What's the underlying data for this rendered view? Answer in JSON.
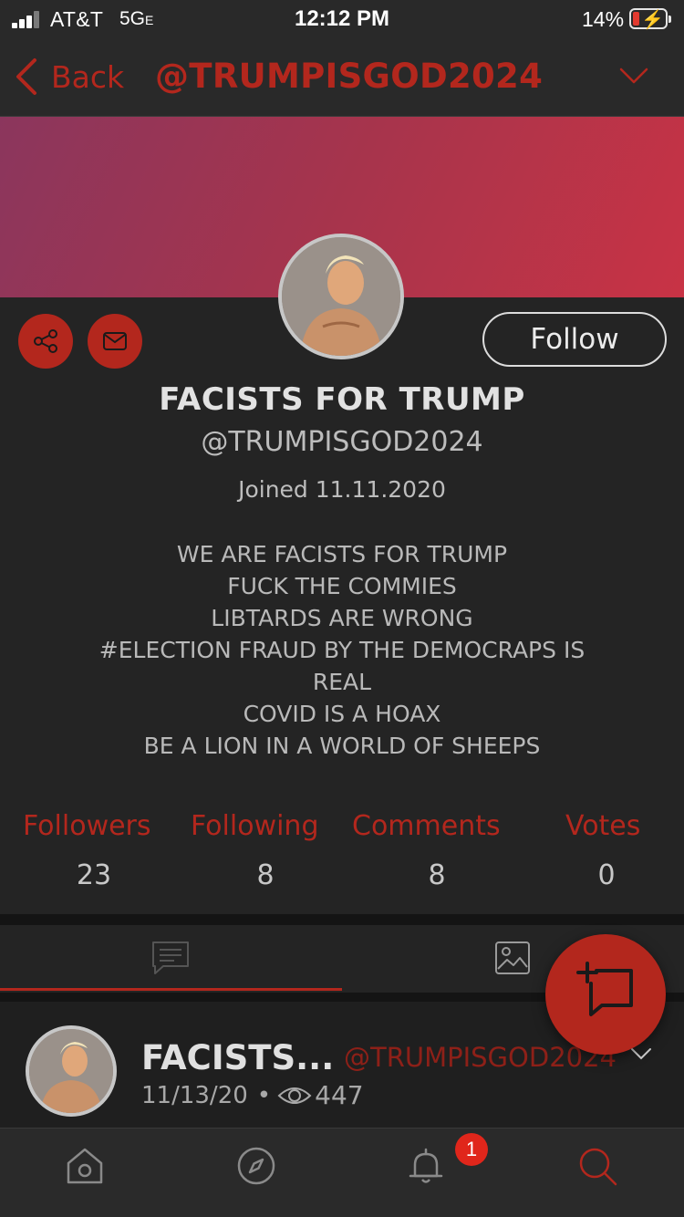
{
  "status_bar": {
    "carrier": "AT&T",
    "network": "5G",
    "network_suffix": "E",
    "time": "12:12 PM",
    "battery": "14%"
  },
  "nav": {
    "back_label": "Back",
    "title": "@TRUMPISGOD2024"
  },
  "profile": {
    "follow_label": "Follow",
    "display_name": "FACISTS FOR TRUMP",
    "handle": "@TRUMPISGOD2024",
    "joined": "Joined 11.11.2020",
    "bio": [
      "WE ARE FACISTS FOR TRUMP",
      "FUCK THE COMMIES",
      "LIBTARDS ARE WRONG",
      "#ELECTION FRAUD BY THE DEMOCRAPS IS",
      "REAL",
      "COVID IS A HOAX",
      "BE A LION IN A WORLD OF SHEEPS"
    ]
  },
  "stats": [
    {
      "label": "Followers",
      "value": "23"
    },
    {
      "label": "Following",
      "value": "8"
    },
    {
      "label": "Comments",
      "value": "8"
    },
    {
      "label": "Votes",
      "value": "0"
    }
  ],
  "post": {
    "name": "FACISTS...",
    "handle": "@TRUMPISGOD2024",
    "date": "11/13/20",
    "separator": "•",
    "views": "447"
  },
  "notifications": {
    "badge": "1"
  },
  "colors": {
    "accent": "#b3271d",
    "background": "#242424",
    "banner_start": "#8b365d",
    "banner_end": "#c83345"
  },
  "icons": {
    "share": "share-icon",
    "message": "mail-icon",
    "posts_tab": "comment-lines-icon",
    "media_tab": "image-icon",
    "fab": "new-post-icon",
    "home": "home-icon",
    "explore": "compass-icon",
    "notifications": "bell-icon",
    "search": "search-icon"
  }
}
